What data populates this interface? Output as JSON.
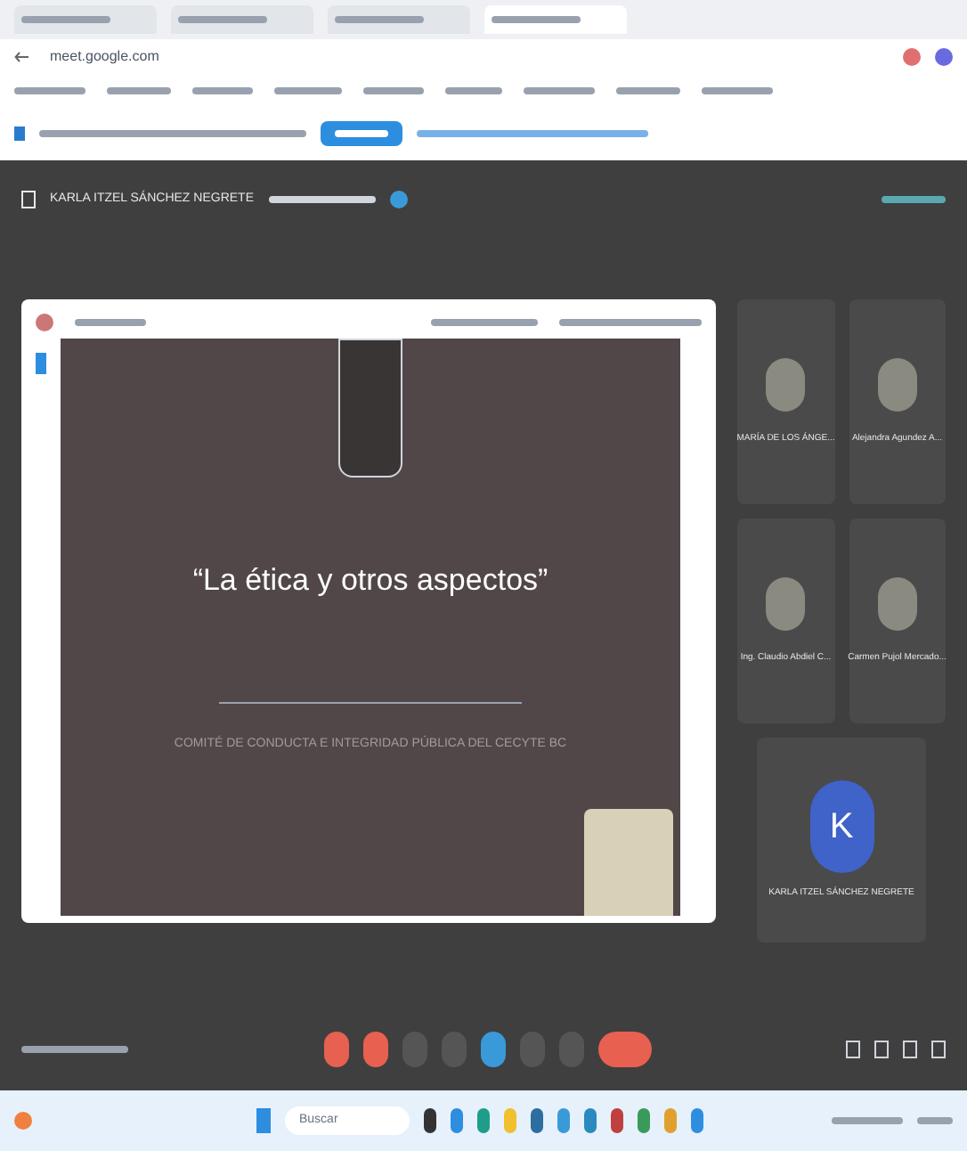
{
  "browser": {
    "tabs": [
      {
        "selected": false
      },
      {
        "selected": false
      },
      {
        "selected": false
      },
      {
        "selected": true
      }
    ],
    "address": "meet.google.com"
  },
  "meeting": {
    "presenter_label": "KARLA ITZEL SÁNCHEZ NEGRETE",
    "slide": {
      "title": "“La ética y otros aspectos”",
      "subtitle": "COMITÉ DE CONDUCTA E INTEGRIDAD PÚBLICA DEL CECYTE BC"
    },
    "participants": [
      {
        "name": "MARÍA DE LOS ÁNGE...",
        "kind": "photo"
      },
      {
        "name": "Alejandra Agundez A...",
        "kind": "photo"
      },
      {
        "name": "Ing. Claudio Abdiel C...",
        "kind": "photo"
      },
      {
        "name": "Carmen Pujol Mercado...",
        "kind": "photo"
      }
    ],
    "self": {
      "initial": "K",
      "name": "KARLA ITZEL SÁNCHEZ NEGRETE"
    },
    "controls": [
      {
        "kind": "red"
      },
      {
        "kind": "red"
      },
      {
        "kind": "gray"
      },
      {
        "kind": "gray"
      },
      {
        "kind": "blue"
      },
      {
        "kind": "gray"
      },
      {
        "kind": "gray"
      },
      {
        "kind": "end"
      }
    ]
  },
  "taskbar": {
    "search": "Buscar"
  }
}
